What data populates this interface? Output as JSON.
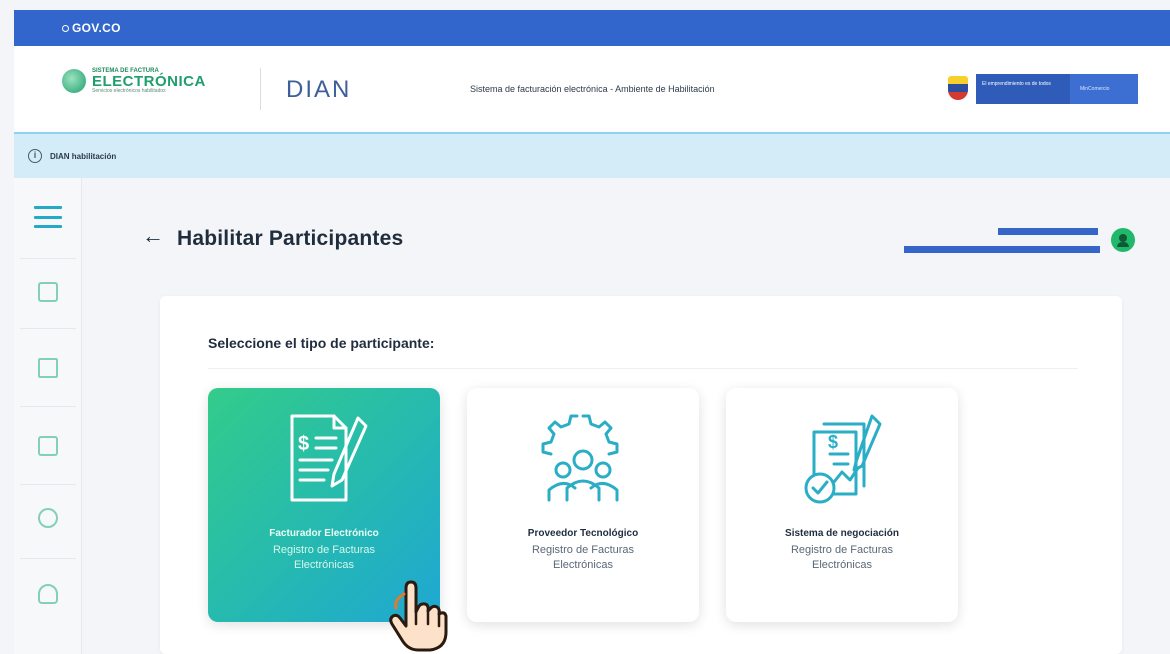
{
  "gov_bar": {
    "logo_text": "GOV.CO"
  },
  "header": {
    "sfe_small": "SISTEMA DE FACTURA",
    "sfe_big": "ELECTRÓNICA",
    "sfe_tiny": "Servicios electrónicos habilitados",
    "dian_logo": "DIAN",
    "title": "Sistema de facturación electrónica - Ambiente de Habilitación",
    "ministry_left": "El emprendimiento es de todos",
    "ministry_right": "MinComercio"
  },
  "info_bar": {
    "icon": "i",
    "text": "DIAN habilitación"
  },
  "page": {
    "back_icon": "←",
    "title": "Habilitar Participantes",
    "select_label": "Seleccione el tipo de participante:"
  },
  "participant_types": [
    {
      "title": "Facturador Electrónico",
      "subtitle": "Registro de Facturas Electrónicas",
      "active": true
    },
    {
      "title": "Proveedor Tecnológico",
      "subtitle": "Registro de Facturas Electrónicas",
      "active": false
    },
    {
      "title": "Sistema de negociación",
      "subtitle": "Registro de Facturas Electrónicas",
      "active": false
    }
  ],
  "sidebar": {
    "items": [
      "menu-icon",
      "dashboard-icon",
      "document-icon",
      "report-icon",
      "settings-icon",
      "lightbulb-icon"
    ]
  },
  "colors": {
    "gov_blue": "#3366cc",
    "accent_teal": "#25a9c8",
    "card_green": "#33cc8a"
  }
}
